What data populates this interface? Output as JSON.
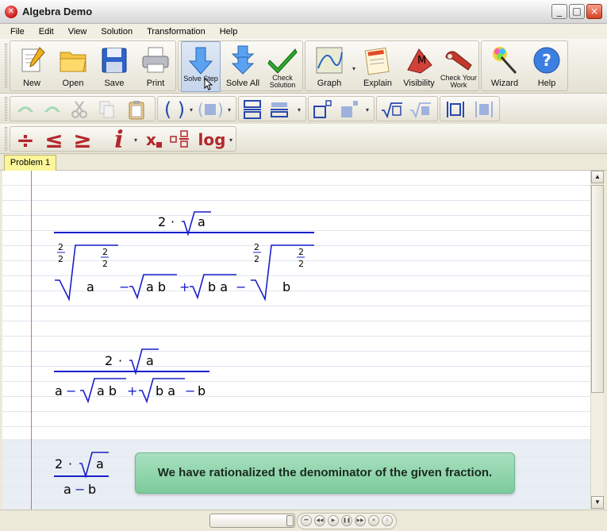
{
  "window": {
    "title": "Algebra Demo",
    "minimize": "_",
    "maximize": "□",
    "close": "×"
  },
  "menu": [
    "File",
    "Edit",
    "View",
    "Solution",
    "Transformation",
    "Help"
  ],
  "toolbar": {
    "new": "New",
    "open": "Open",
    "save": "Save",
    "print": "Print",
    "solve_step": "Solve Step",
    "solve_all": "Solve All",
    "check_solution": "Check Solution",
    "graph": "Graph",
    "explain": "Explain",
    "visibility": "Visibility",
    "check_work": "Check Your Work",
    "wizard": "Wizard",
    "help": "Help",
    "visibility_glyph": "M",
    "help_glyph": "?"
  },
  "symbols": {
    "divide": "÷",
    "le": "≤",
    "ge": "≥",
    "italic": "i",
    "subscript": "x",
    "log": "log"
  },
  "tabs": [
    "Problem 1"
  ],
  "expressions": {
    "step1": {
      "numerator": "2 · √a",
      "denominator": "²⁄₂√(a^(2/2)) − √(a b) + √(b a) − ²⁄₂√(b^(2/2))",
      "num_coef": "2",
      "dot": "·",
      "a": "a",
      "b": "b",
      "ab": "a b",
      "ba": "b a",
      "two": "2",
      "minus": "−",
      "plus": "+"
    },
    "step2": {
      "numerator": "2 · √a",
      "denominator": "a − √(a b) + √(b a) − b"
    },
    "step3": {
      "numerator": "2 · √a",
      "denominator": "a − b"
    }
  },
  "message": "We have rationalized the denominator of the given fraction.",
  "playback": [
    "⏮",
    "◀◀",
    "▶",
    "❚❚",
    "▶▶",
    "✕",
    "i"
  ]
}
